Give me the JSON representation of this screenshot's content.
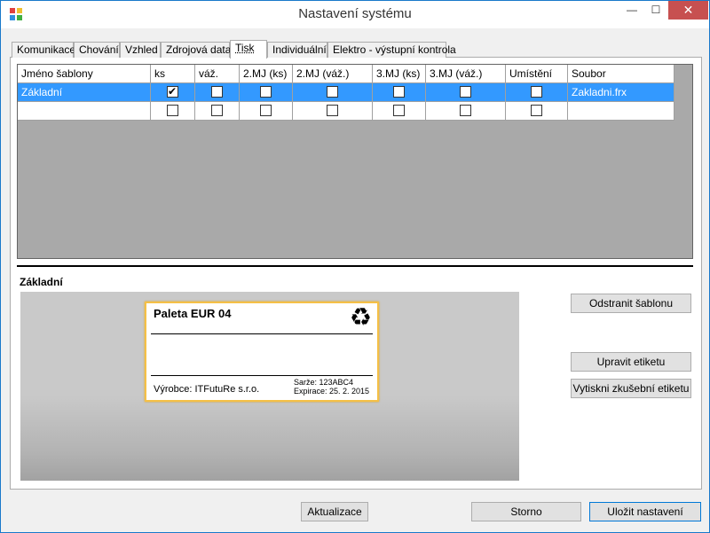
{
  "window": {
    "title": "Nastavení systému",
    "min_glyph": "—",
    "max_glyph": "☐",
    "close_glyph": "✕"
  },
  "tabs": [
    {
      "label": "Komunikace"
    },
    {
      "label": "Chování"
    },
    {
      "label": "Vzhled"
    },
    {
      "label": "Zdrojová data"
    },
    {
      "label": "Tisk",
      "active": true
    },
    {
      "label": "Individuální"
    },
    {
      "label": "Elektro - výstupní kontrola"
    }
  ],
  "grid": {
    "columns": [
      "Jméno šablony",
      "ks",
      "váž.",
      "2.MJ (ks)",
      "2.MJ (váž.)",
      "3.MJ (ks)",
      "3.MJ (váž.)",
      "Umístění",
      "Soubor"
    ],
    "rows": [
      {
        "name": "Základní",
        "checks": [
          true,
          false,
          false,
          false,
          false,
          false,
          false
        ],
        "file": "Zakladni.frx",
        "selected": true
      },
      {
        "name": "",
        "checks": [
          false,
          false,
          false,
          false,
          false,
          false,
          false
        ],
        "file": "",
        "selected": false
      }
    ]
  },
  "section_title": "Základní",
  "label_preview": {
    "title": "Paleta EUR 04",
    "recycle_glyph": "♻",
    "maker": "Výrobce: ITFutuRe s.r.o.",
    "batch": "Sarže: 123ABC4",
    "expiry": "Expirace: 25. 2. 2015"
  },
  "buttons": {
    "remove_template": "Odstranit šablonu",
    "edit_label": "Upravit etiketu",
    "print_test": "Vytiskni zkušební etiketu",
    "refresh": "Aktualizace",
    "cancel": "Storno",
    "save": "Uložit nastavení"
  },
  "colors": {
    "selection": "#3399ff",
    "close_button": "#c75050",
    "label_border": "#f5c046"
  }
}
